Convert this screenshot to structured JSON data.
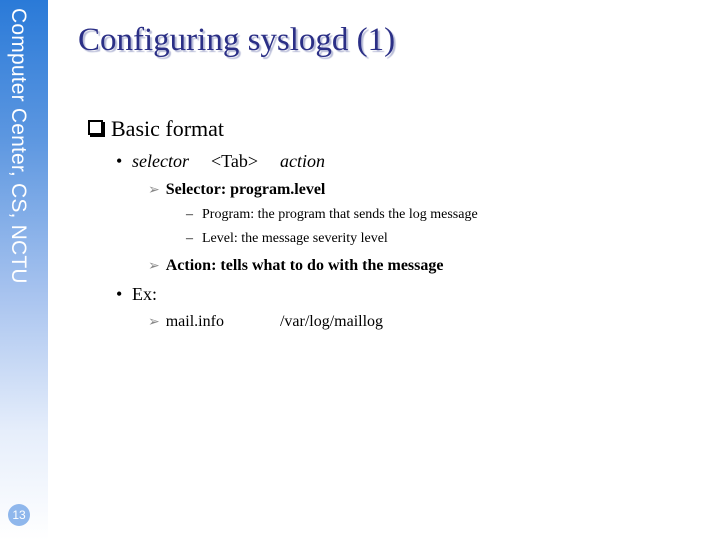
{
  "sidebar": {
    "org_text": "Computer Center, CS, NCTU",
    "page_number": "13"
  },
  "slide": {
    "title": "Configuring syslogd (1)",
    "basic_format": {
      "heading": "Basic format",
      "format_line": {
        "bullet": "•",
        "selector": "selector",
        "tab": "<Tab>",
        "action": "action"
      },
      "selector_item": {
        "arrow": "Ø",
        "text": "Selector:  program.level"
      },
      "selector_details": [
        {
          "dash": "–",
          "text": "Program: the program that sends the log message"
        },
        {
          "dash": "–",
          "text": "Level: the message severity level"
        }
      ],
      "action_item": {
        "arrow": "Ø",
        "text": "Action: tells what to do with the message"
      },
      "example": {
        "bullet": "•",
        "label": "Ex:",
        "arrow": "Ø",
        "selector": "mail.info",
        "action": "/var/log/maillog"
      }
    }
  }
}
